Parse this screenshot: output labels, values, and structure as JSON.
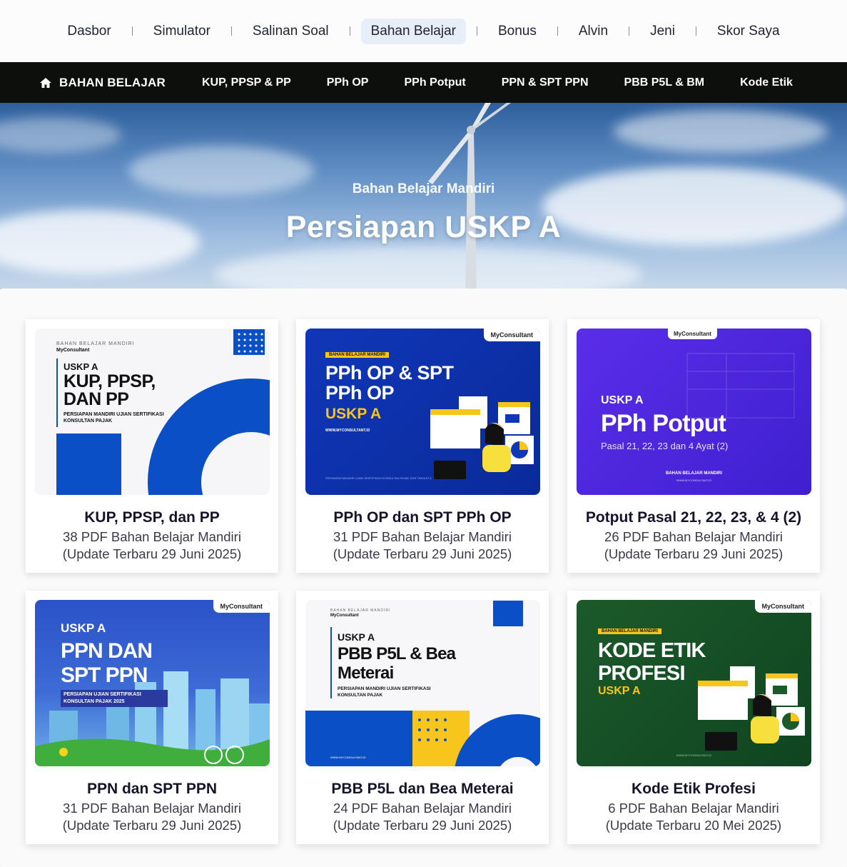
{
  "topnav": {
    "items": [
      "Dasbor",
      "Simulator",
      "Salinan Soal",
      "Bahan Belajar",
      "Bonus",
      "Alvin",
      "Jeni",
      "Skor Saya"
    ],
    "active": "Bahan Belajar"
  },
  "subnav": {
    "home_label": "BAHAN BELAJAR",
    "links": [
      "KUP, PPSP & PP",
      "PPh OP",
      "PPh Potput",
      "PPN & SPT PPN",
      "PBB P5L & BM",
      "Kode Etik"
    ]
  },
  "hero": {
    "subtitle": "Bahan Belajar Mandiri",
    "title": "Persiapan USKP A"
  },
  "cards": [
    {
      "title": "KUP, PPSP, dan PP",
      "count": "38 PDF Bahan Belajar Mandiri",
      "update": "(Update Terbaru 29 Juni 2025)",
      "thumb": {
        "kicker": "BAHAN BELAJAR MANDIRI",
        "brand": "MyConsultant",
        "level": "USKP A",
        "heading": "KUP, PPSP, DAN PP",
        "tagline": "PERSIAPAN MANDIRI UJIAN SERTIFIKASI KONSULTAN PAJAK"
      }
    },
    {
      "title": "PPh OP dan SPT PPh OP",
      "count": "31 PDF Bahan Belajar Mandiri",
      "update": "(Update Terbaru 29 Juni 2025)",
      "thumb": {
        "kicker": "BAHAN BELAJAR MANDIRI",
        "brand": "MyConsultant",
        "level": "USKP A",
        "heading": "PPh OP & SPT PPh OP",
        "url": "WWW.MYCONSULTANT.ID",
        "footer": "PERSIAPAN MANDIRI UJIAN SERTIFIKASI KONSULTAN PAJAK 2025 TINGKAT A"
      }
    },
    {
      "title": "Potput Pasal 21, 22, 23, & 4 (2)",
      "count": "26 PDF Bahan Belajar Mandiri",
      "update": "(Update Terbaru 29 Juni 2025)",
      "thumb": {
        "brand": "MyConsultant",
        "level": "USKP A",
        "heading": "PPh Potput",
        "subheading": "Pasal 21, 22, 23 dan 4 Ayat (2)",
        "kicker": "BAHAN BELAJAR MANDIRI",
        "url": "WWW.MYCONSULTANT.ID"
      }
    },
    {
      "title": "PPN dan SPT PPN",
      "count": "31 PDF Bahan Belajar Mandiri",
      "update": "(Update Terbaru 29 Juni 2025)",
      "thumb": {
        "brand": "MyConsultant",
        "level": "USKP A",
        "heading": "PPN DAN SPT PPN",
        "tagline": "PERSIAPAN UJIAN SERTIFIKASI KONSULTAN PAJAK 2025"
      }
    },
    {
      "title": "PBB P5L dan Bea Meterai",
      "count": "24 PDF Bahan Belajar Mandiri",
      "update": "(Update Terbaru 29 Juni 2025)",
      "thumb": {
        "kicker": "BAHAN BELAJAR MANDIRI",
        "brand": "MyConsultant",
        "level": "USKP A",
        "heading": "PBB P5L & Bea Meterai",
        "tagline": "PERSIAPAN MANDIRI UJIAN SERTIFIKASI KONSULTAN PAJAK",
        "url": "WWW.MYCONSULTANT.ID"
      }
    },
    {
      "title": "Kode Etik Profesi",
      "count": "6 PDF Bahan Belajar Mandiri",
      "update": "(Update Terbaru 20 Mei 2025)",
      "thumb": {
        "kicker": "BAHAN BELAJAR MANDIRI",
        "brand": "MyConsultant",
        "heading": "KODE ETIK PROFESI",
        "level": "USKP A",
        "url": "WWW.MYCONSULTANT.ID"
      }
    }
  ]
}
